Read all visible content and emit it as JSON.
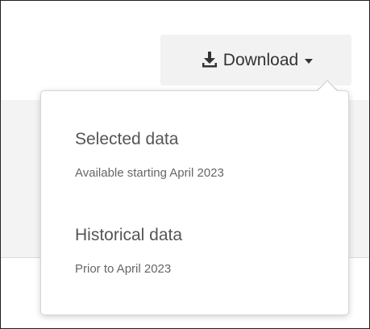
{
  "toolbar": {
    "download_label": "Download",
    "download_icon": "download-icon"
  },
  "menu": {
    "items": [
      {
        "title": "Selected data",
        "subtitle": "Available starting April 2023"
      },
      {
        "title": "Historical data",
        "subtitle": "Prior to April 2023"
      }
    ]
  },
  "colors": {
    "button_bg": "#f2f2f2",
    "text_dark": "#333333",
    "text_muted": "#666666"
  }
}
